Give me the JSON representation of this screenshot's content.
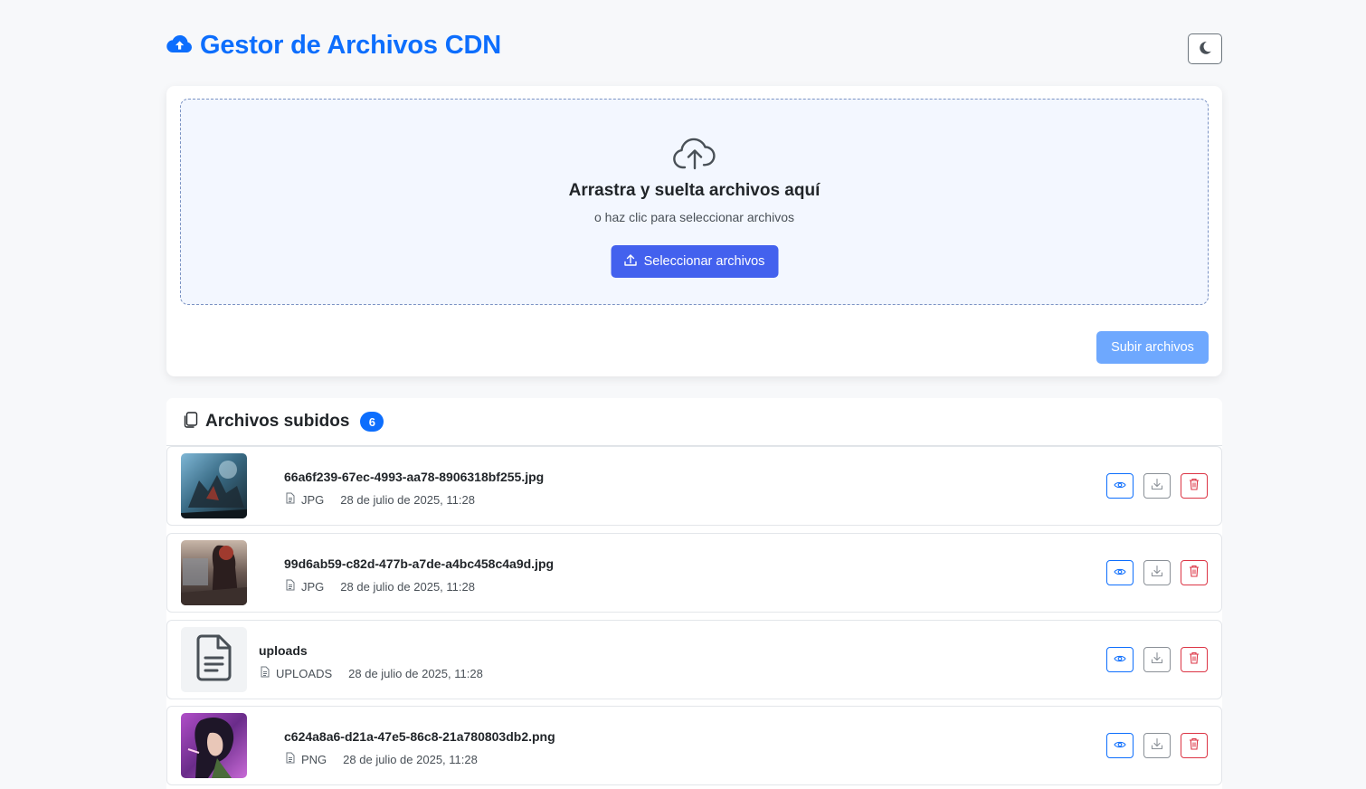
{
  "header": {
    "title": "Gestor de Archivos CDN",
    "brand_icon": "cloud-upload-icon",
    "theme_toggle_icon": "moon-icon"
  },
  "upload": {
    "icon": "cloud-upload-icon",
    "title": "Arrastra y suelta archivos aquí",
    "subtitle": "o haz clic para seleccionar archivos",
    "select_button_label": "Seleccionar archivos",
    "upload_button_label": "Subir archivos"
  },
  "files": {
    "header_icon": "files-icon",
    "title": "Archivos subidos",
    "count": "6",
    "items": [
      {
        "name": "66a6f239-67ec-4993-aa78-8906318bf255.jpg",
        "type": "JPG",
        "date": "28 de julio de 2025, 11:28",
        "thumbnail": "image"
      },
      {
        "name": "99d6ab59-c82d-477b-a7de-a4bc458c4a9d.jpg",
        "type": "JPG",
        "date": "28 de julio de 2025, 11:28",
        "thumbnail": "image"
      },
      {
        "name": "uploads",
        "type": "UPLOADS",
        "date": "28 de julio de 2025, 11:28",
        "thumbnail": "file-icon"
      },
      {
        "name": "c624a8a6-d21a-47e5-86c8-21a780803db2.png",
        "type": "PNG",
        "date": "28 de julio de 2025, 11:28",
        "thumbnail": "image"
      }
    ]
  },
  "colors": {
    "primary": "#0d6efd",
    "select_button": "#4361ee",
    "upload_button_disabled": "#6ea8fe",
    "danger": "#dc3545",
    "background": "#f7f8fa"
  }
}
